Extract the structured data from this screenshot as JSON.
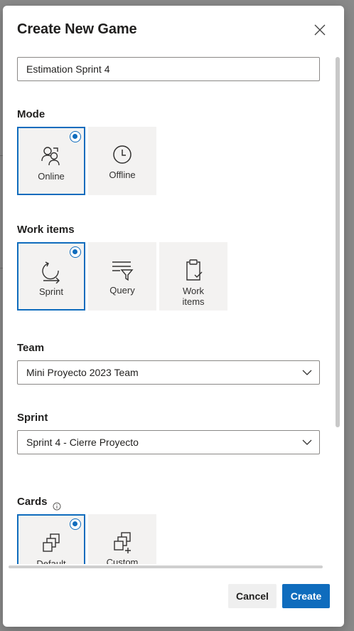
{
  "dialog": {
    "title": "Create New Game",
    "game_name_value": "Estimation Sprint 4"
  },
  "mode": {
    "label": "Mode",
    "options": [
      {
        "label": "Online",
        "icon": "users-icon",
        "selected": true
      },
      {
        "label": "Offline",
        "icon": "clock-icon",
        "selected": false
      }
    ]
  },
  "work_items": {
    "label": "Work items",
    "options": [
      {
        "label": "Sprint",
        "icon": "sprint-cycle-icon",
        "selected": true
      },
      {
        "label": "Query",
        "icon": "filter-list-icon",
        "selected": false
      },
      {
        "label_line1": "Work",
        "label_line2": "items",
        "icon": "clipboard-check-icon",
        "selected": false
      }
    ]
  },
  "team": {
    "label": "Team",
    "value": "Mini Proyecto 2023 Team"
  },
  "sprint": {
    "label": "Sprint",
    "value": "Sprint 4 - Cierre Proyecto"
  },
  "cards": {
    "label": "Cards",
    "info_icon": "info-icon",
    "options": [
      {
        "label": "Default",
        "icon": "card-stack-icon",
        "selected": true
      },
      {
        "label": "Custom",
        "icon": "card-stack-add-icon",
        "selected": false
      }
    ]
  },
  "footer": {
    "cancel_label": "Cancel",
    "create_label": "Create"
  },
  "colors": {
    "accent": "#0f6cbd",
    "tile_background": "#f3f2f1"
  }
}
